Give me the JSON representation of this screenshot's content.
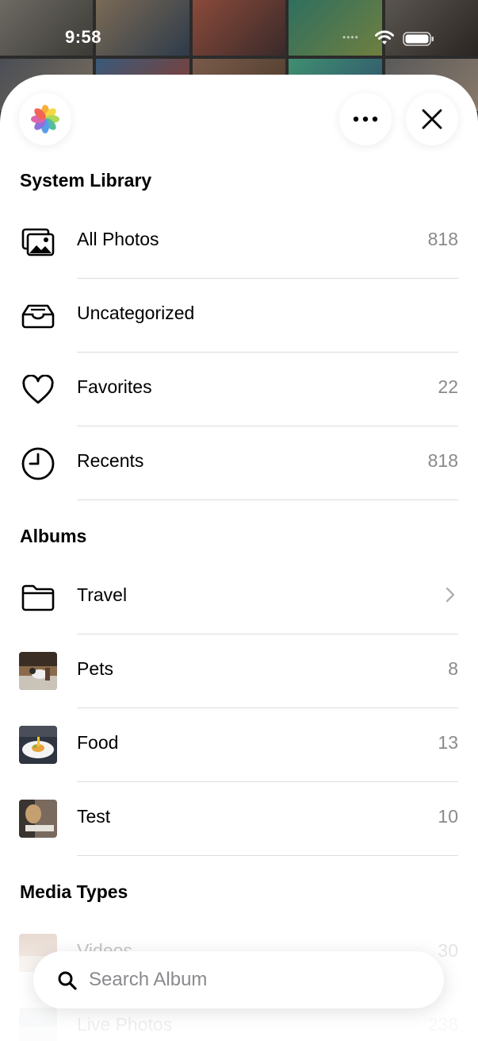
{
  "status_bar": {
    "time": "9:58",
    "cellular_icon": "cellular-dots-icon",
    "wifi_icon": "wifi-icon",
    "battery_icon": "battery-icon"
  },
  "header": {
    "app_icon": "photos-app-icon",
    "more_icon": "ellipsis-icon",
    "close_icon": "close-icon"
  },
  "sections": {
    "system_library": {
      "title": "System Library",
      "items": [
        {
          "label": "All Photos",
          "count": "818",
          "icon": "photo-stack-icon"
        },
        {
          "label": "Uncategorized",
          "count": "",
          "icon": "tray-icon"
        },
        {
          "label": "Favorites",
          "count": "22",
          "icon": "heart-icon"
        },
        {
          "label": "Recents",
          "count": "818",
          "icon": "clock-icon"
        }
      ]
    },
    "albums": {
      "title": "Albums",
      "items": [
        {
          "label": "Travel",
          "count": "",
          "icon": "folder-icon",
          "chevron": "chevron-right-icon"
        },
        {
          "label": "Pets",
          "count": "8",
          "icon": "album-thumbnail"
        },
        {
          "label": "Food",
          "count": "13",
          "icon": "album-thumbnail"
        },
        {
          "label": "Test",
          "count": "10",
          "icon": "album-thumbnail"
        }
      ]
    },
    "media_types": {
      "title": "Media Types",
      "items": [
        {
          "label": "Videos",
          "count": "30",
          "icon": "album-thumbnail"
        },
        {
          "label": "Live Photos",
          "count": "238",
          "icon": "album-thumbnail"
        }
      ]
    }
  },
  "search": {
    "placeholder": "Search Album",
    "value": "",
    "icon": "search-icon"
  },
  "colors": {
    "accent_text": "#000000",
    "secondary_text": "#8a8a8e",
    "divider": "#dcdcdc",
    "sheet_bg": "#ffffff"
  }
}
